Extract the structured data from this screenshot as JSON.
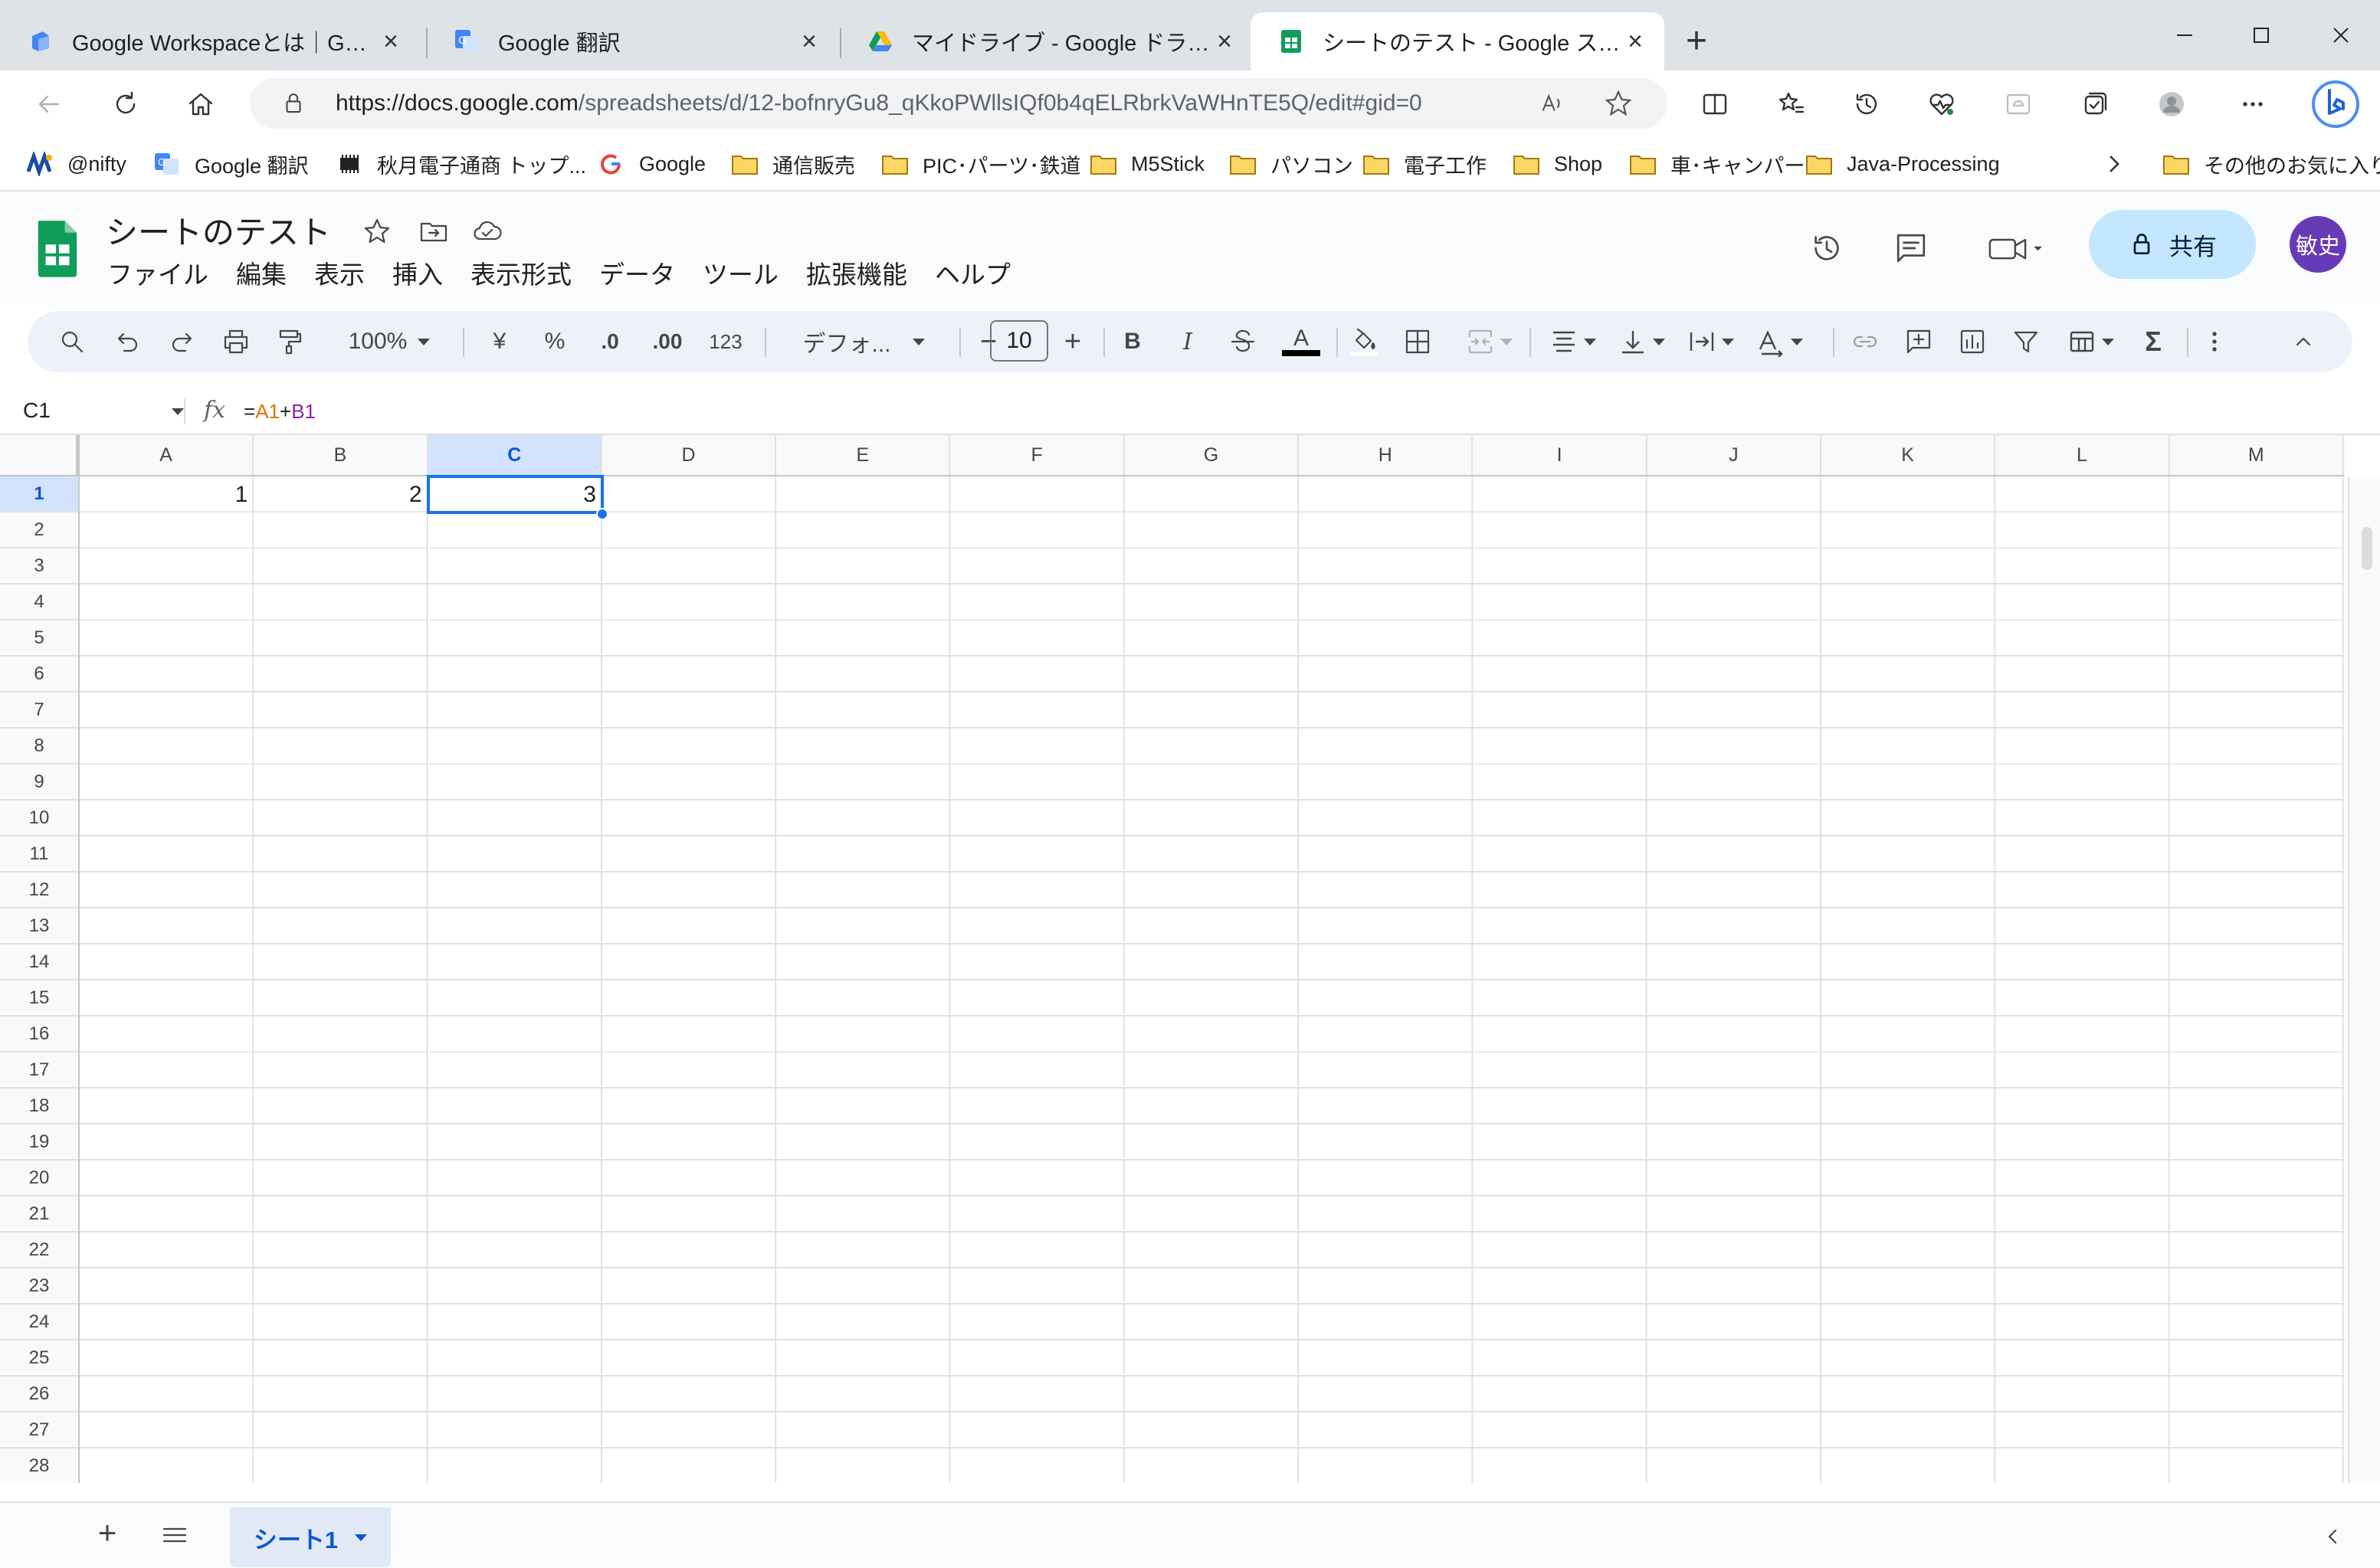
{
  "browser": {
    "tabs": [
      {
        "title": "Google Workspaceとは｜Google Wo",
        "icon": "google-workspace-icon",
        "active": false
      },
      {
        "title": "Google 翻訳",
        "icon": "google-translate-icon",
        "active": false
      },
      {
        "title": "マイドライブ - Google ドライブ",
        "icon": "google-drive-icon",
        "active": false
      },
      {
        "title": "シートのテスト - Google スプレッドシート",
        "icon": "google-sheets-icon",
        "active": true
      }
    ],
    "new_tab_label": "+",
    "url_domain": "https://docs.google.com",
    "url_path": "/spreadsheets/d/12-bofnryGu8_qKkoPWllsIQf0b4qELRbrkVaWHnTE5Q/edit#gid=0",
    "bookmarks": [
      {
        "label": "@nifty",
        "icon": "nifty-icon"
      },
      {
        "label": "Google 翻訳",
        "icon": "google-translate-icon"
      },
      {
        "label": "秋月電子通商 トップ...",
        "icon": "chip-icon"
      },
      {
        "label": "Google",
        "icon": "google-icon"
      },
      {
        "label": "通信販売",
        "icon": "folder-icon"
      },
      {
        "label": "PIC･パーツ･鉄道",
        "icon": "folder-icon"
      },
      {
        "label": "M5Stick",
        "icon": "folder-icon"
      },
      {
        "label": "パソコン",
        "icon": "folder-icon"
      },
      {
        "label": "電子工作",
        "icon": "folder-icon"
      },
      {
        "label": "Shop",
        "icon": "folder-icon"
      },
      {
        "label": "車･キャンパー",
        "icon": "folder-icon"
      },
      {
        "label": "Java-Processing",
        "icon": "folder-icon"
      }
    ],
    "other_bookmarks": "その他のお気に入り"
  },
  "sheets": {
    "doc_title": "シートのテスト",
    "menu": [
      "ファイル",
      "編集",
      "表示",
      "挿入",
      "表示形式",
      "データ",
      "ツール",
      "拡張機能",
      "ヘルプ"
    ],
    "share_label": "共有",
    "avatar_text": "敏史",
    "toolbar": {
      "zoom": "100%",
      "currency": "¥",
      "percent": "%",
      "dec_decrease": ".0",
      "dec_increase": ".00",
      "number_format": "123",
      "font": "デフォ...",
      "font_size": "10",
      "bold": "B",
      "italic": "I",
      "text_color_glyph": "A",
      "sum_glyph": "Σ"
    },
    "name_box": "C1",
    "fx_label": "fx",
    "formula": {
      "eq": "=",
      "ref1": "A1",
      "op": "+",
      "ref2": "B1"
    },
    "ref_colors": {
      "ref1": "#e37400",
      "ref2": "#8e24aa",
      "selection": "#1a73e8"
    },
    "columns": [
      "A",
      "B",
      "C",
      "D",
      "E",
      "F",
      "G",
      "H",
      "I",
      "J",
      "K",
      "L",
      "M"
    ],
    "rows": [
      "1",
      "2",
      "3",
      "4",
      "5",
      "6",
      "7",
      "8",
      "9",
      "10",
      "11",
      "12",
      "13",
      "14",
      "15",
      "16",
      "17",
      "18",
      "19",
      "20",
      "21",
      "22",
      "23",
      "24",
      "25",
      "26",
      "27",
      "28"
    ],
    "selected_cell": {
      "col": "C",
      "row": "1"
    },
    "cells": [
      {
        "col": "A",
        "row": "1",
        "value": "1"
      },
      {
        "col": "B",
        "row": "1",
        "value": "2"
      },
      {
        "col": "C",
        "row": "1",
        "value": "3"
      }
    ],
    "sheet_tabs": [
      {
        "label": "シート1",
        "active": true
      }
    ],
    "add_sheet": "+"
  }
}
